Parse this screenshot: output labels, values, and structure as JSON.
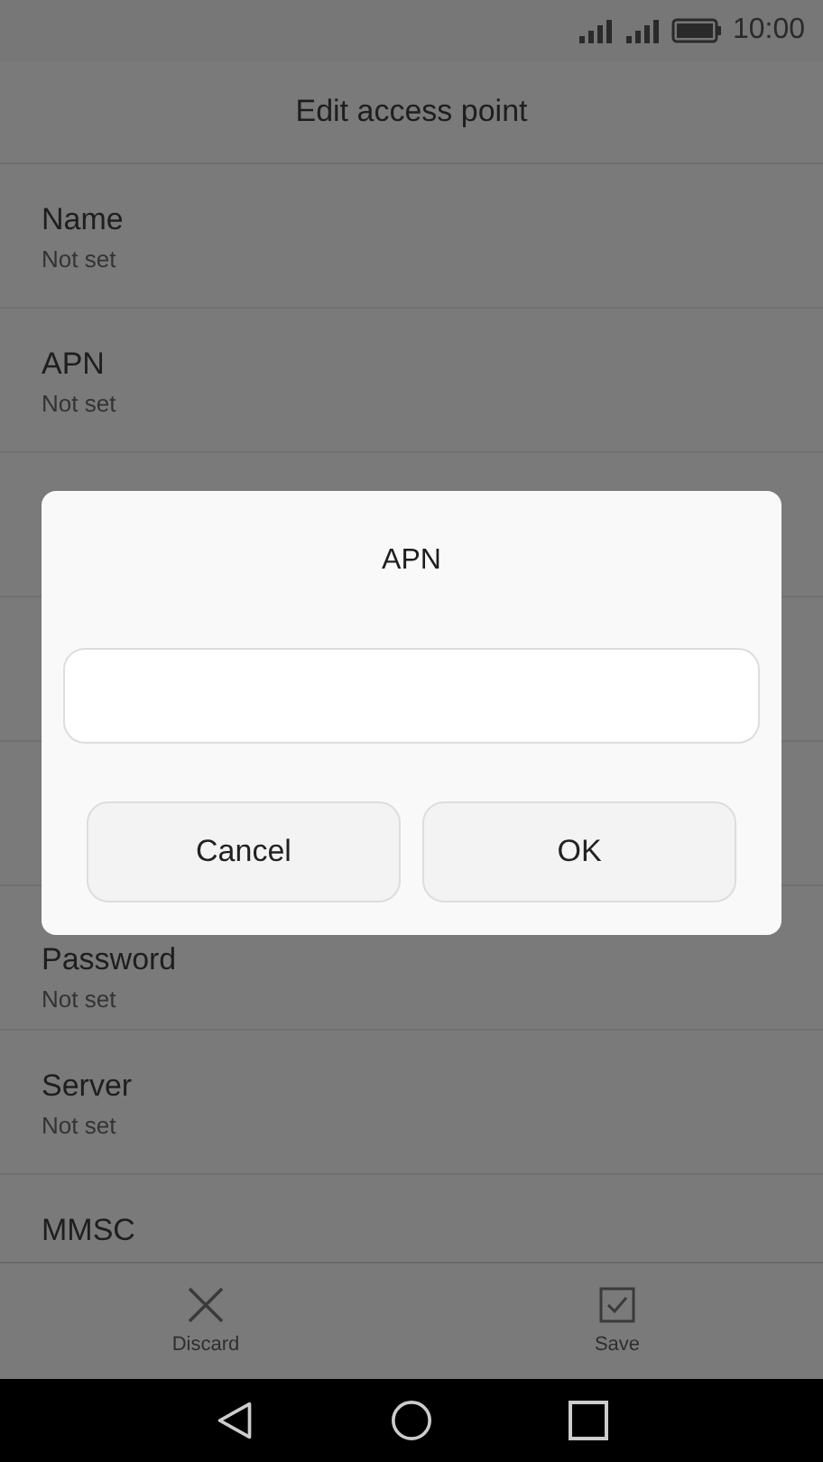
{
  "status_bar": {
    "time": "10:00"
  },
  "title": "Edit access point",
  "fields_top": [
    {
      "label": "Name",
      "value": "Not set"
    },
    {
      "label": "APN",
      "value": "Not set"
    }
  ],
  "fields_bottom": [
    {
      "label": "Password",
      "value": "Not set"
    },
    {
      "label": "Server",
      "value": "Not set"
    },
    {
      "label": "MMSC"
    }
  ],
  "dialog": {
    "title": "APN",
    "buttons": [
      {
        "label": "Cancel"
      },
      {
        "label": "OK"
      }
    ]
  },
  "actions": [
    {
      "kind": "discard",
      "label": "Discard"
    },
    {
      "kind": "save",
      "label": "Save"
    }
  ]
}
